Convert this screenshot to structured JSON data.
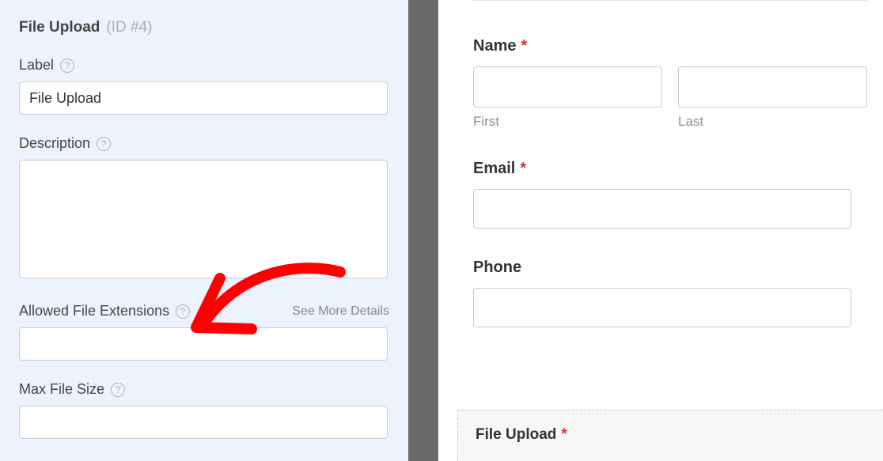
{
  "panel": {
    "title": "File Upload",
    "id_text": "(ID #4)",
    "label_label": "Label",
    "label_value": "File Upload",
    "description_label": "Description",
    "description_value": "",
    "allowed_ext_label": "Allowed File Extensions",
    "allowed_ext_value": "",
    "see_more": "See More Details",
    "max_file_size_label": "Max File Size",
    "max_file_size_value": ""
  },
  "preview": {
    "name_label": "Name",
    "first_sublabel": "First",
    "last_sublabel": "Last",
    "email_label": "Email",
    "phone_label": "Phone",
    "upload_label": "File Upload"
  }
}
